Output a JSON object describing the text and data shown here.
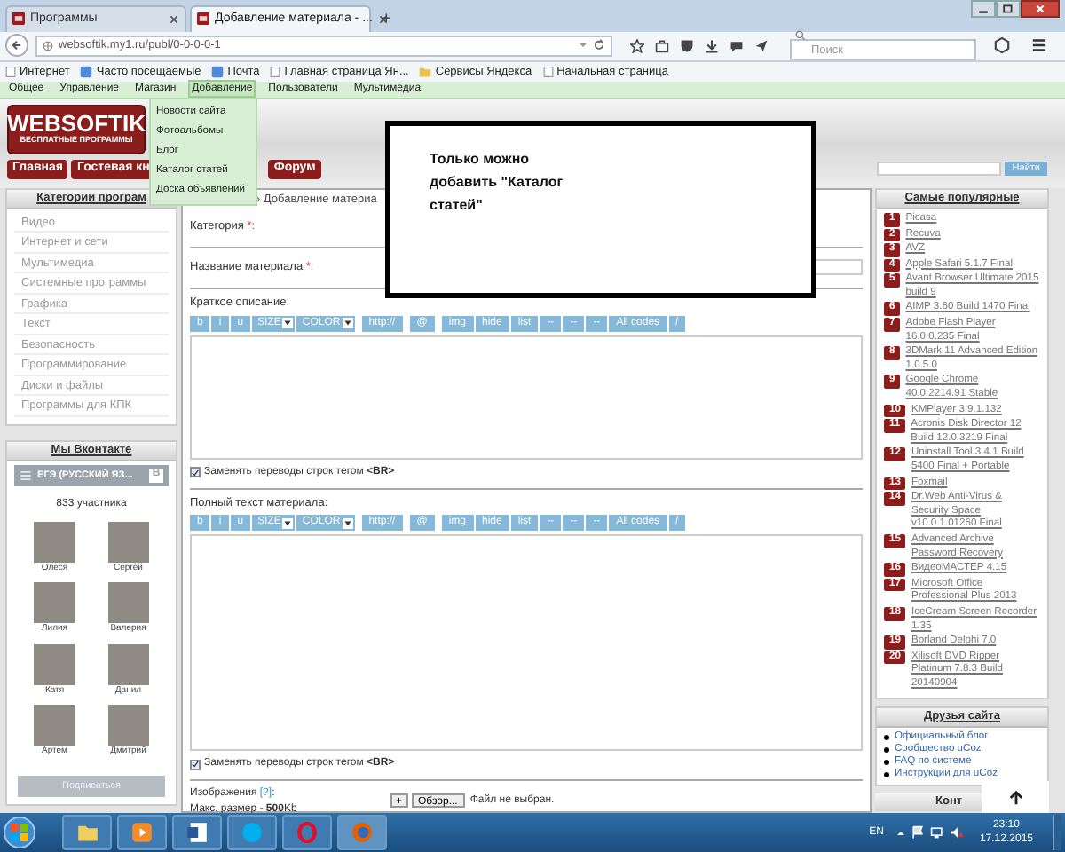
{
  "browser": {
    "tabs": [
      {
        "title": "Программы",
        "selected": false
      },
      {
        "title": "Добавление материала - ...",
        "selected": true
      }
    ],
    "new_tab": "+",
    "url": "websoftik.my1.ru/publ/0-0-0-0-1",
    "search": {
      "placeholder": "Поиск"
    },
    "bookmarks": [
      {
        "label": "Интернет",
        "kind": "page"
      },
      {
        "label": "Часто посещаемые",
        "kind": "blue"
      },
      {
        "label": "Почта",
        "kind": "blue"
      },
      {
        "label": "Главная страница Ян...",
        "kind": "page"
      },
      {
        "label": "Сервисы Яндекса",
        "kind": "folder"
      },
      {
        "label": "Начальная страница",
        "kind": "page"
      }
    ]
  },
  "admin_menu": {
    "items": [
      {
        "label": "Общее",
        "selected": false
      },
      {
        "label": "Управление",
        "selected": false
      },
      {
        "label": "Магазин",
        "selected": false
      },
      {
        "label": "Добавление",
        "selected": true
      },
      {
        "label": "Пользователи",
        "selected": false
      },
      {
        "label": "Мультимедиа",
        "selected": false
      }
    ],
    "dropdown": [
      "Новости сайта",
      "Фотоальбомы",
      "Блог",
      "Каталог статей",
      "Доска объявлений"
    ]
  },
  "site": {
    "logo": {
      "title": "WEBSOFTIK",
      "subtitle": "БЕСПЛАТНЫЕ ПРОГРАММЫ"
    },
    "nav": [
      "Главная",
      "Гостевая кн",
      "Форум"
    ],
    "search_button": "Найти"
  },
  "categories": {
    "title": "Категории програм",
    "items": [
      "Видео",
      "Интернет и сети",
      "Мультимедиа",
      "Системные программы",
      "Графика",
      "Текст",
      "Безопасность",
      "Программирование",
      "Диски и файлы",
      "Программы для КПК"
    ]
  },
  "vk": {
    "title": "Мы Вконтакте",
    "group": "ЕГЭ (РУССКИЙ ЯЗ...",
    "group_badge": "B",
    "members": "833 участника",
    "people": [
      "Олеся",
      "Сергей",
      "Лилия",
      "Валерия",
      "Катя",
      "Данил",
      "Артем",
      "Дмитрий"
    ],
    "button": "Подписаться"
  },
  "form": {
    "breadcrumb": "» Добавление материа",
    "category": {
      "label": "Категория",
      "marker": "*:"
    },
    "title": {
      "label": "Название материала",
      "marker": "*:"
    },
    "short_label": "Краткое описание:",
    "toolbar_1": [
      {
        "label": "b",
        "kind": "button"
      },
      {
        "label": "i",
        "kind": "button"
      },
      {
        "label": "u",
        "kind": "button"
      },
      {
        "label": "SIZE",
        "kind": "select"
      },
      {
        "label": "COLOR",
        "kind": "select"
      },
      {
        "label": "http://",
        "kind": "button"
      },
      {
        "label": "@",
        "kind": "button"
      },
      {
        "label": "img",
        "kind": "button"
      },
      {
        "label": "hide",
        "kind": "button"
      },
      {
        "label": "list",
        "kind": "button"
      },
      {
        "label": "--",
        "kind": "button"
      },
      {
        "label": "--",
        "kind": "button"
      },
      {
        "label": "--",
        "kind": "button"
      },
      {
        "label": "All codes",
        "kind": "button"
      },
      {
        "label": "/",
        "kind": "button"
      }
    ],
    "checkbox_1": {
      "label": "Заменять переводы строк тегом **<BR>**",
      "checked": true
    },
    "full_label": "Полный текст материала:",
    "toolbar_2": [
      {
        "label": "b",
        "kind": "button"
      },
      {
        "label": "i",
        "kind": "button"
      },
      {
        "label": "u",
        "kind": "button"
      },
      {
        "label": "SIZE",
        "kind": "select"
      },
      {
        "label": "COLOR",
        "kind": "select"
      },
      {
        "label": "http://",
        "kind": "button"
      },
      {
        "label": "@",
        "kind": "button"
      },
      {
        "label": "img",
        "kind": "button"
      },
      {
        "label": "hide",
        "kind": "button"
      },
      {
        "label": "list",
        "kind": "button"
      },
      {
        "label": "--",
        "kind": "button"
      },
      {
        "label": "--",
        "kind": "button"
      },
      {
        "label": "--",
        "kind": "button"
      },
      {
        "label": "All codes",
        "kind": "button"
      },
      {
        "label": "/",
        "kind": "button"
      }
    ],
    "checkbox_2": {
      "label": "Заменять переводы строк тегом **<BR>**",
      "checked": true
    },
    "images_label": "Изображения",
    "images_help": "[?]",
    "images_colon": ":",
    "max_size": "Макс. размер - **500**Kb",
    "add_button": "+",
    "browse_button": "Обзор...",
    "file_status": "Файл не выбран."
  },
  "notice": "Только можно добавить \"Каталог статей\"",
  "popular": {
    "title": "Самые популярные",
    "items": [
      {
        "rank": "1",
        "name": "Picasa"
      },
      {
        "rank": "2",
        "name": "Recuva"
      },
      {
        "rank": "3",
        "name": "AVZ"
      },
      {
        "rank": "4",
        "name": "Apple Safari 5.1.7 Final"
      },
      {
        "rank": "5",
        "name": "Avant Browser Ultimate 2015 build 9"
      },
      {
        "rank": "6",
        "name": "AIMP 3.60 Build 1470 Final"
      },
      {
        "rank": "7",
        "name": "Adobe Flash Player 16.0.0.235 Final"
      },
      {
        "rank": "8",
        "name": "3DMark 11 Advanced Edition 1.0.5.0"
      },
      {
        "rank": "9",
        "name": "Google Chrome 40.0.2214.91 Stable"
      },
      {
        "rank": "10",
        "name": "KMPlayer 3.9.1.132"
      },
      {
        "rank": "11",
        "name": "Acronis Disk Director 12 Build 12.0.3219 Final"
      },
      {
        "rank": "12",
        "name": "Uninstall Tool 3.4.1 Build 5400 Final + Portable"
      },
      {
        "rank": "13",
        "name": "Foxmail"
      },
      {
        "rank": "14",
        "name": "Dr.Web Anti-Virus & Security Space v10.0.1.01260 Final"
      },
      {
        "rank": "15",
        "name": "Advanced Archive Password Recovery"
      },
      {
        "rank": "16",
        "name": "ВидеоМАСТЕР 4.15"
      },
      {
        "rank": "17",
        "name": "Microsoft Office Professional Plus 2013"
      },
      {
        "rank": "18",
        "name": "IceCream Screen Recorder 1.35"
      },
      {
        "rank": "19",
        "name": "Borland Delphi 7.0"
      },
      {
        "rank": "20",
        "name": "Xilisoft DVD Ripper Platinum 7.8.3 Build 20140904"
      }
    ]
  },
  "friends": {
    "title": "Друзья сайта",
    "items": [
      "Официальный блог",
      "Сообщество uCoz",
      "FAQ по системе",
      "Инструкции для uCoz"
    ]
  },
  "contacts_title": "Конт",
  "taskbar": {
    "language": "EN",
    "time": "23:10",
    "date": "17.12.2015"
  }
}
